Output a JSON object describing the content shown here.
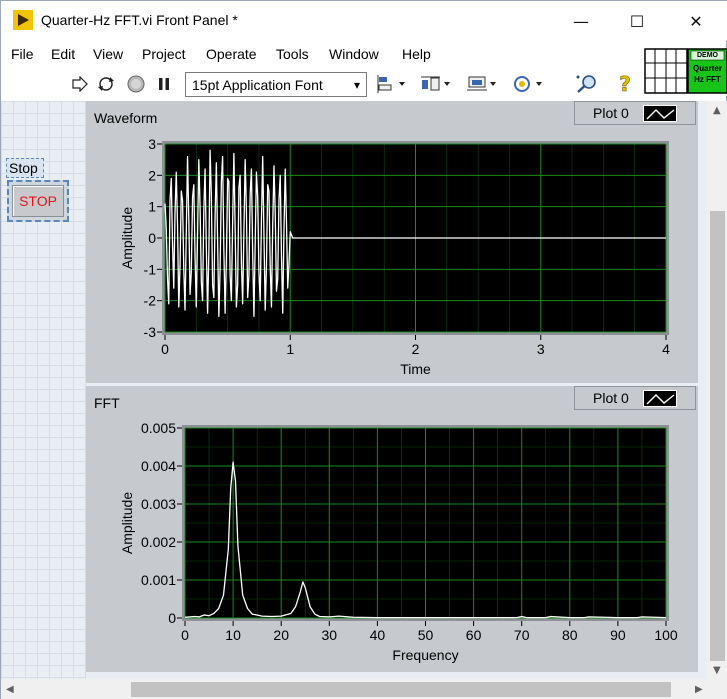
{
  "window": {
    "title": "Quarter-Hz FFT.vi Front Panel *",
    "controls": {
      "minimize": "—",
      "maximize": "☐",
      "close": "✕"
    }
  },
  "menu": [
    "File",
    "Edit",
    "View",
    "Project",
    "Operate",
    "Tools",
    "Window",
    "Help"
  ],
  "toolbar": {
    "font": "15pt Application Font",
    "dropdown_arrow": "▾"
  },
  "vi_icon": {
    "badge": "DEMO",
    "line1": "Quarter",
    "line2": "Hz FFT"
  },
  "stop_control": {
    "label": "Stop",
    "button_text": "STOP",
    "text_color": "#e8141a"
  },
  "colors": {
    "plot_bg": "#000000",
    "grid": "#1c8a1c",
    "trace": "#ffffff",
    "frame": "#c6c9ce"
  },
  "chart_data": [
    {
      "type": "line",
      "title": "Waveform",
      "xlabel": "Time",
      "ylabel": "Amplitude",
      "xlim": [
        0,
        4
      ],
      "ylim": [
        -3,
        3
      ],
      "xticks": [
        "0",
        "1",
        "2",
        "3",
        "4"
      ],
      "yticks": [
        "3",
        "2",
        "1",
        "0",
        "-1",
        "-2",
        "-3"
      ],
      "grid": true,
      "legend": "Plot 0",
      "series": [
        {
          "name": "Plot 0",
          "x": [
            0,
            0.01,
            0.02,
            0.03,
            0.04,
            0.05,
            0.06,
            0.07,
            0.08,
            0.09,
            0.1,
            0.11,
            0.12,
            0.13,
            0.14,
            0.15,
            0.16,
            0.17,
            0.18,
            0.19,
            0.2,
            0.21,
            0.22,
            0.23,
            0.24,
            0.25,
            0.26,
            0.27,
            0.28,
            0.29,
            0.3,
            0.31,
            0.32,
            0.33,
            0.34,
            0.35,
            0.36,
            0.37,
            0.38,
            0.39,
            0.4,
            0.41,
            0.42,
            0.43,
            0.44,
            0.45,
            0.46,
            0.47,
            0.48,
            0.49,
            0.5,
            0.51,
            0.52,
            0.53,
            0.54,
            0.55,
            0.56,
            0.57,
            0.58,
            0.59,
            0.6,
            0.61,
            0.62,
            0.63,
            0.64,
            0.65,
            0.66,
            0.67,
            0.68,
            0.69,
            0.7,
            0.71,
            0.72,
            0.73,
            0.74,
            0.75,
            0.76,
            0.77,
            0.78,
            0.79,
            0.8,
            0.81,
            0.82,
            0.83,
            0.84,
            0.85,
            0.86,
            0.87,
            0.88,
            0.89,
            0.9,
            0.91,
            0.92,
            0.93,
            0.94,
            0.95,
            0.96,
            0.97,
            0.98,
            0.99,
            1.0,
            1.02,
            4.0
          ],
          "y": [
            1.1,
            0.3,
            -1.3,
            -2.1,
            1.2,
            1.9,
            -0.2,
            -1.6,
            0.8,
            2.1,
            0.4,
            -2.2,
            -0.9,
            1.5,
            1.2,
            -1.0,
            -2.3,
            0.2,
            2.6,
            0.6,
            -1.8,
            -1.1,
            1.3,
            1.7,
            -0.6,
            -2.2,
            0.1,
            2.5,
            1.0,
            -1.4,
            -2.0,
            0.9,
            2.2,
            -0.3,
            -2.4,
            -0.5,
            2.8,
            1.4,
            -1.5,
            -1.9,
            0.7,
            2.4,
            -0.1,
            -2.5,
            -1.0,
            1.8,
            2.6,
            -0.4,
            -2.4,
            -0.7,
            1.9,
            1.8,
            -1.2,
            -2.0,
            0.5,
            2.7,
            0.3,
            -2.2,
            -1.5,
            1.6,
            2.0,
            -0.8,
            -2.1,
            0.2,
            2.5,
            0.9,
            -1.9,
            -1.2,
            1.4,
            2.2,
            -0.5,
            -2.5,
            -0.2,
            2.1,
            1.3,
            -1.1,
            -2.0,
            0.6,
            2.6,
            0.1,
            -2.3,
            -0.9,
            1.7,
            1.5,
            -0.9,
            -2.2,
            0.4,
            2.3,
            0.8,
            -1.7,
            -1.3,
            1.2,
            2.0,
            -0.6,
            -2.4,
            0.3,
            2.2,
            0.5,
            -1.6,
            -0.8,
            0.2,
            0.0,
            0.0
          ]
        }
      ]
    },
    {
      "type": "line",
      "title": "FFT",
      "xlabel": "Frequency",
      "ylabel": "Amplitude",
      "xlim": [
        0,
        100
      ],
      "ylim": [
        0,
        0.005
      ],
      "xticks": [
        "0",
        "10",
        "20",
        "30",
        "40",
        "50",
        "60",
        "70",
        "80",
        "90",
        "100"
      ],
      "yticks": [
        "0.005",
        "0.004",
        "0.003",
        "0.002",
        "0.001",
        "0"
      ],
      "grid": true,
      "legend": "Plot 0",
      "series": [
        {
          "name": "Plot 0",
          "x": [
            0,
            2,
            3,
            4,
            5,
            6,
            7,
            8,
            9,
            9.5,
            10,
            10.5,
            11,
            12,
            13,
            14,
            15,
            16,
            18,
            20,
            22,
            23,
            24,
            24.5,
            25,
            26,
            27,
            28,
            30,
            32,
            35,
            40,
            50,
            60,
            69,
            70,
            71,
            75,
            76,
            80,
            83,
            84,
            90,
            94,
            95,
            100
          ],
          "y": [
            2e-05,
            4e-05,
            3e-05,
            8e-05,
            6e-05,
            0.00012,
            0.00025,
            0.0006,
            0.0018,
            0.0034,
            0.0041,
            0.0036,
            0.0019,
            0.0006,
            0.00025,
            0.0001,
            8e-05,
            5e-05,
            4e-05,
            5e-05,
            0.00012,
            0.0003,
            0.0007,
            0.00095,
            0.0008,
            0.0003,
            0.0001,
            4e-05,
            3e-05,
            5e-05,
            2e-05,
            1e-05,
            1e-05,
            1e-05,
            1e-05,
            4e-05,
            1e-05,
            1e-05,
            4e-05,
            1e-05,
            1e-05,
            3e-05,
            1e-05,
            1e-05,
            3e-05,
            1e-05
          ]
        }
      ]
    }
  ]
}
